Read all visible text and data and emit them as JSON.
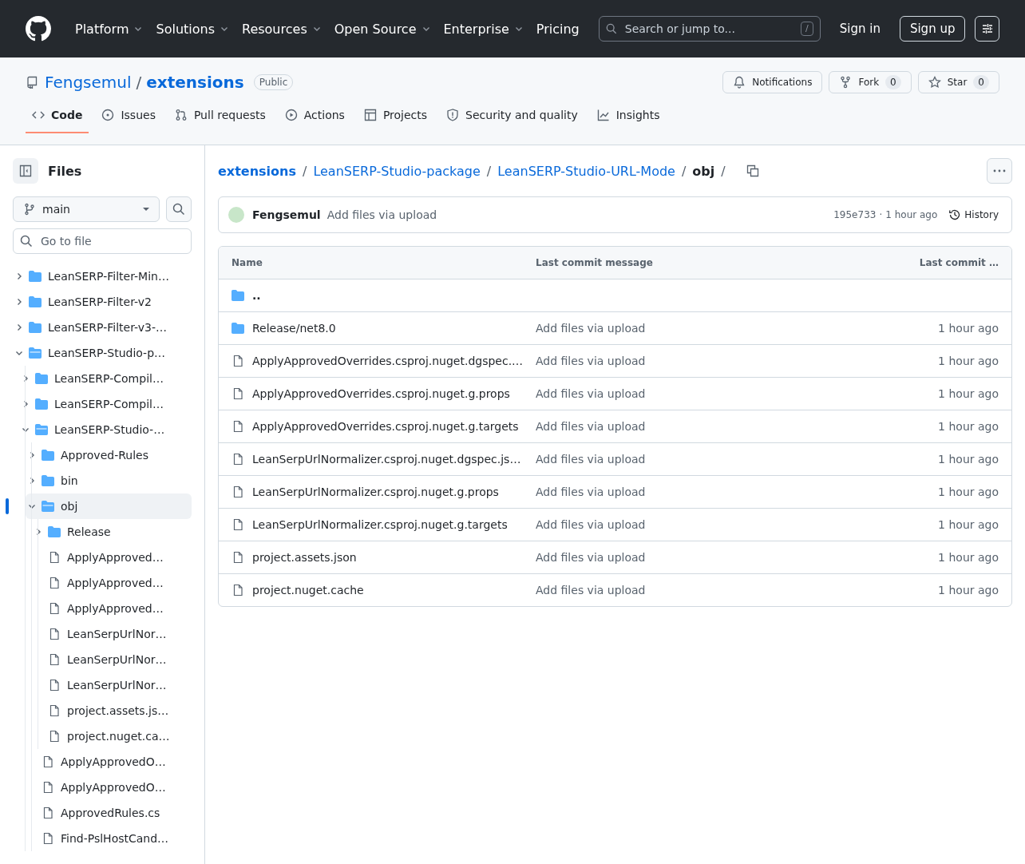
{
  "header": {
    "nav": [
      {
        "label": "Platform",
        "dropdown": true
      },
      {
        "label": "Solutions",
        "dropdown": true
      },
      {
        "label": "Resources",
        "dropdown": true
      },
      {
        "label": "Open Source",
        "dropdown": true
      },
      {
        "label": "Enterprise",
        "dropdown": true
      },
      {
        "label": "Pricing",
        "dropdown": false
      }
    ],
    "search": {
      "placeholder": "Search or jump to...",
      "key": "/"
    },
    "sign_in": "Sign in",
    "sign_up": "Sign up"
  },
  "repo": {
    "owner": "Fengsemul",
    "separator": "/",
    "name": "extensions",
    "visibility": "Public",
    "actions": [
      {
        "kind": "bell",
        "label": "Notifications"
      },
      {
        "kind": "fork",
        "label": "Fork",
        "count": "0"
      },
      {
        "kind": "star",
        "label": "Star",
        "count": "0"
      }
    ],
    "tabs": [
      {
        "kind": "code",
        "label": "Code",
        "selected": true
      },
      {
        "kind": "issue",
        "label": "Issues",
        "selected": false
      },
      {
        "kind": "pr",
        "label": "Pull requests",
        "selected": false
      },
      {
        "kind": "play",
        "label": "Actions",
        "selected": false
      },
      {
        "kind": "table",
        "label": "Projects",
        "selected": false
      },
      {
        "kind": "shield",
        "label": "Security and quality",
        "selected": false
      },
      {
        "kind": "graph",
        "label": "Insights",
        "selected": false
      }
    ]
  },
  "sidebar": {
    "title": "Files",
    "branch": "main",
    "filter_placeholder": "Go to file",
    "tree": [
      {
        "kind": "folder",
        "name": "LeanSERP-Filter-Min…",
        "expanded": false,
        "selected": false
      },
      {
        "kind": "folder",
        "name": "LeanSERP-Filter-v2",
        "expanded": false,
        "selected": false
      },
      {
        "kind": "folder",
        "name": "LeanSERP-Filter-v3-…",
        "expanded": false,
        "selected": false
      },
      {
        "kind": "folder",
        "name": "LeanSERP-Studio-p…",
        "expanded": true,
        "selected": false,
        "children": [
          {
            "kind": "folder",
            "name": "LeanSERP-Compil…",
            "expanded": false,
            "selected": false
          },
          {
            "kind": "folder",
            "name": "LeanSERP-Compil…",
            "expanded": false,
            "selected": false
          },
          {
            "kind": "folder",
            "name": "LeanSERP-Studio-…",
            "expanded": true,
            "selected": false,
            "children": [
              {
                "kind": "folder",
                "name": "Approved-Rules",
                "expanded": false,
                "selected": false
              },
              {
                "kind": "folder",
                "name": "bin",
                "expanded": false,
                "selected": false
              },
              {
                "kind": "folder",
                "name": "obj",
                "expanded": true,
                "selected": true,
                "children": [
                  {
                    "kind": "folder",
                    "name": "Release",
                    "expanded": false,
                    "selected": false
                  },
                  {
                    "kind": "file",
                    "name": "ApplyApproved…",
                    "selected": false
                  },
                  {
                    "kind": "file",
                    "name": "ApplyApproved…",
                    "selected": false
                  },
                  {
                    "kind": "file",
                    "name": "ApplyApproved…",
                    "selected": false
                  },
                  {
                    "kind": "file",
                    "name": "LeanSerpUrlNor…",
                    "selected": false
                  },
                  {
                    "kind": "file",
                    "name": "LeanSerpUrlNor…",
                    "selected": false
                  },
                  {
                    "kind": "file",
                    "name": "LeanSerpUrlNor…",
                    "selected": false
                  },
                  {
                    "kind": "file",
                    "name": "project.assets.js…",
                    "selected": false
                  },
                  {
                    "kind": "file",
                    "name": "project.nuget.ca…",
                    "selected": false
                  }
                ]
              },
              {
                "kind": "file",
                "name": "ApplyApprovedO…",
                "selected": false
              },
              {
                "kind": "file",
                "name": "ApplyApprovedO…",
                "selected": false
              },
              {
                "kind": "file",
                "name": "ApprovedRules.cs",
                "selected": false
              },
              {
                "kind": "file",
                "name": "Find-PslHostCand…",
                "selected": false
              }
            ]
          }
        ]
      }
    ]
  },
  "breadcrumb": [
    {
      "label": "extensions",
      "kind": "repo"
    },
    {
      "label": "LeanSERP-Studio-package",
      "kind": "link"
    },
    {
      "label": "LeanSERP-Studio-URL-Mode",
      "kind": "link"
    },
    {
      "label": "obj",
      "kind": "current"
    }
  ],
  "breadcrumb_separator": "/",
  "commit": {
    "author": "Fengsemul",
    "message": "Add files via upload",
    "sha": "195e733",
    "separator": "·",
    "age": "1 hour ago",
    "history": "History"
  },
  "table": {
    "columns": [
      "Name",
      "Last commit message",
      "Last commit …"
    ],
    "rows": [
      {
        "kind": "parent",
        "name": "..",
        "message": "",
        "date": ""
      },
      {
        "kind": "folder",
        "name": "Release/net8.0",
        "message": "Add files via upload",
        "date": "1 hour ago"
      },
      {
        "kind": "file",
        "name": "ApplyApprovedOverrides.csproj.nuget.dgspec.…",
        "message": "Add files via upload",
        "date": "1 hour ago"
      },
      {
        "kind": "file",
        "name": "ApplyApprovedOverrides.csproj.nuget.g.props",
        "message": "Add files via upload",
        "date": "1 hour ago"
      },
      {
        "kind": "file",
        "name": "ApplyApprovedOverrides.csproj.nuget.g.targets",
        "message": "Add files via upload",
        "date": "1 hour ago"
      },
      {
        "kind": "file",
        "name": "LeanSerpUrlNormalizer.csproj.nuget.dgspec.js…",
        "message": "Add files via upload",
        "date": "1 hour ago"
      },
      {
        "kind": "file",
        "name": "LeanSerpUrlNormalizer.csproj.nuget.g.props",
        "message": "Add files via upload",
        "date": "1 hour ago"
      },
      {
        "kind": "file",
        "name": "LeanSerpUrlNormalizer.csproj.nuget.g.targets",
        "message": "Add files via upload",
        "date": "1 hour ago"
      },
      {
        "kind": "file",
        "name": "project.assets.json",
        "message": "Add files via upload",
        "date": "1 hour ago"
      },
      {
        "kind": "file",
        "name": "project.nuget.cache",
        "message": "Add files via upload",
        "date": "1 hour ago"
      }
    ]
  }
}
